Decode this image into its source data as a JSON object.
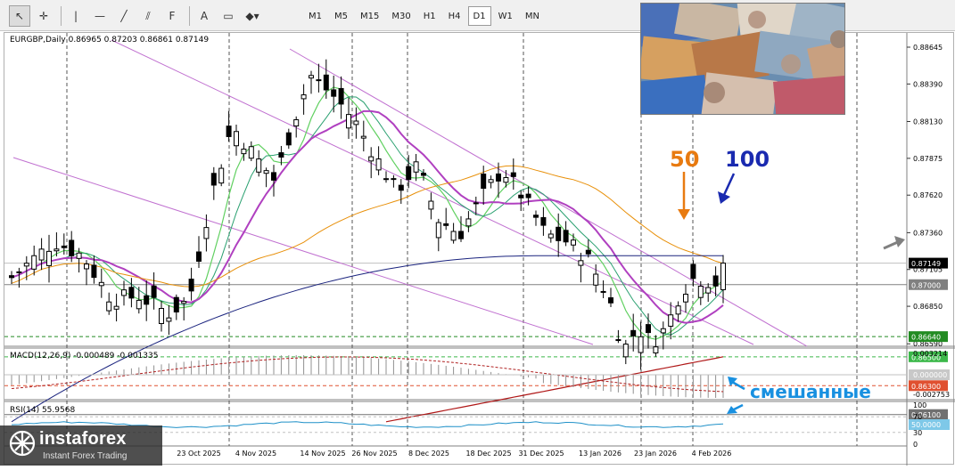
{
  "toolbar": {
    "tools": [
      {
        "name": "cursor-icon",
        "glyph": "↖",
        "active": true
      },
      {
        "name": "crosshair-icon",
        "glyph": "✛",
        "active": false
      },
      {
        "name": "vertical-line-icon",
        "glyph": "|",
        "active": false
      },
      {
        "name": "horizontal-line-icon",
        "glyph": "—",
        "active": false
      },
      {
        "name": "trendline-icon",
        "glyph": "╱",
        "active": false
      },
      {
        "name": "channel-icon",
        "glyph": "⫽",
        "active": false
      },
      {
        "name": "fibonacci-icon",
        "glyph": "F",
        "active": false
      },
      {
        "name": "text-icon",
        "glyph": "A",
        "active": false
      },
      {
        "name": "label-icon",
        "glyph": "▭",
        "active": false
      },
      {
        "name": "shapes-icon",
        "glyph": "◆▾",
        "active": false
      }
    ],
    "timeframes": [
      {
        "label": "M1",
        "active": false
      },
      {
        "label": "M5",
        "active": false
      },
      {
        "label": "M15",
        "active": false
      },
      {
        "label": "M30",
        "active": false
      },
      {
        "label": "H1",
        "active": false
      },
      {
        "label": "H4",
        "active": false
      },
      {
        "label": "D1",
        "active": true
      },
      {
        "label": "W1",
        "active": false
      },
      {
        "label": "MN",
        "active": false
      }
    ]
  },
  "chart": {
    "header": "EURGBP,Daily  0.86965 0.87203 0.86861 0.87149",
    "price_labels": [
      {
        "text": "0.88645",
        "price": 0.88645
      },
      {
        "text": "0.88390",
        "price": 0.8839
      },
      {
        "text": "0.88130",
        "price": 0.8813
      },
      {
        "text": "0.87875",
        "price": 0.87875
      },
      {
        "text": "0.87620",
        "price": 0.8762
      },
      {
        "text": "0.87360",
        "price": 0.8736
      },
      {
        "text": "0.87105",
        "price": 0.87105
      },
      {
        "text": "0.86850",
        "price": 0.8685
      },
      {
        "text": "0.86590",
        "price": 0.8659
      }
    ],
    "tag_labels": [
      {
        "text": "0.87149",
        "price": 0.87149,
        "bg": "#000000",
        "fg": "#ffffff"
      },
      {
        "text": "0.87000",
        "price": 0.87,
        "bg": "#808080",
        "fg": "#ffffff"
      },
      {
        "text": "0.86640",
        "price": 0.8664,
        "bg": "#228b22",
        "fg": "#ffffff"
      },
      {
        "text": "0.86500",
        "price": 0.865,
        "bg": "#3cb84a",
        "fg": "#ffffff"
      },
      {
        "text": "0.86300",
        "price": 0.863,
        "bg": "#e05030",
        "fg": "#ffffff"
      },
      {
        "text": "0.86100",
        "price": 0.861,
        "bg": "#707070",
        "fg": "#ffffff"
      }
    ],
    "date_labels": [
      "23 Oct 2025",
      "4 Nov 2025",
      "14 Nov 2025",
      "26 Nov 2025",
      "8 Dec 2025",
      "18 Dec 2025",
      "31 Dec 2025",
      "13 Jan 2026",
      "23 Jan 2026",
      "4 Feb 2026"
    ],
    "annotation_50": "50",
    "annotation_100": "100",
    "annotation_mixed": "смешанные",
    "colors": {
      "ma_orange": "#e8900a",
      "ma_navy": "#1a237e",
      "ma_purple": "#b040c0",
      "ma_green": "#60d060",
      "ma_teal": "#2aa070",
      "ma_red": "#b01818",
      "channel_purple": "#c070d0",
      "annotation_orange": "#e87a10",
      "annotation_blue": "#1a2ab0",
      "annotation_cyan": "#1890e0",
      "candle": "#000000"
    }
  },
  "macd": {
    "header": "MACD(12,26,9) -0.000489 -0.001335",
    "scale_labels": [
      "0.003214",
      "0.000000",
      "-0.002753"
    ]
  },
  "rsi": {
    "header": "RSI(14) 55.9568",
    "scale_labels": [
      "100",
      "70",
      "50.0000",
      "30",
      "0"
    ]
  },
  "logo": {
    "brand": "instaforex",
    "tagline": "Instant Forex Trading"
  }
}
